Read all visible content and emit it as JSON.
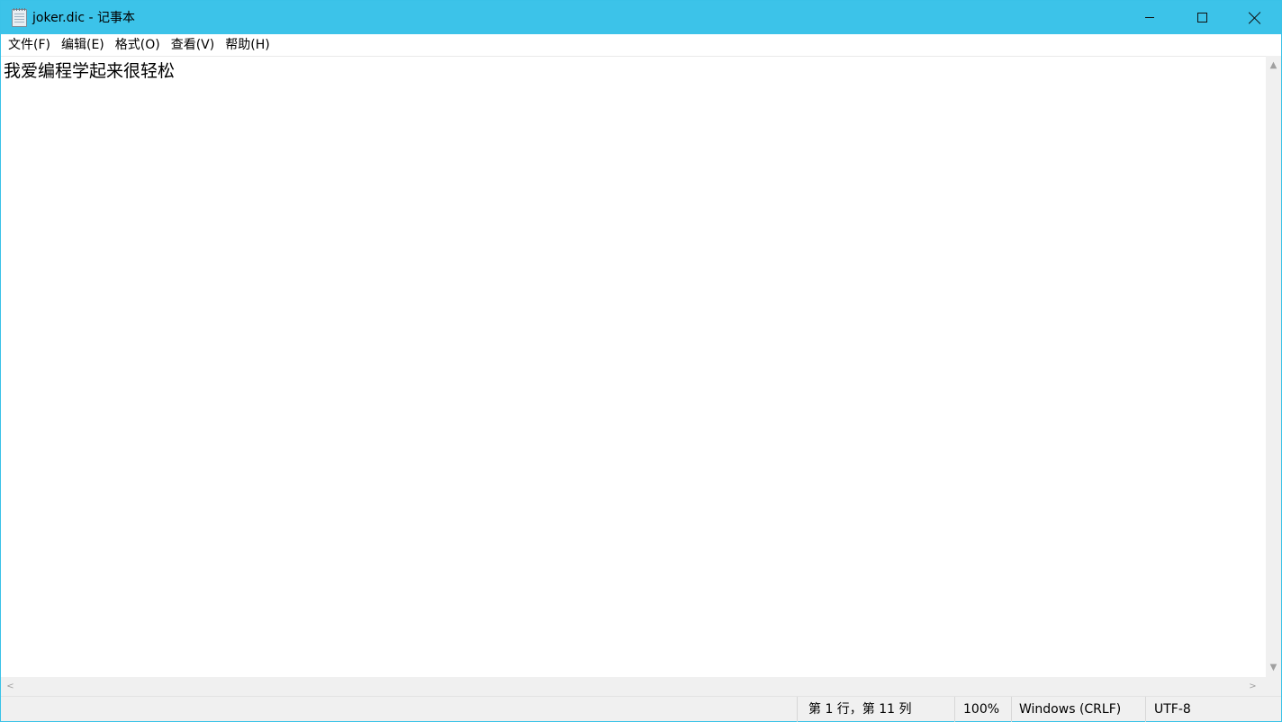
{
  "window": {
    "title": "joker.dic - 记事本",
    "icon": "notepad-icon",
    "controls": {
      "minimize": "minimize-icon",
      "maximize": "maximize-icon",
      "close": "close-icon"
    }
  },
  "menu": {
    "items": [
      {
        "label": "文件(F)"
      },
      {
        "label": "编辑(E)"
      },
      {
        "label": "格式(O)"
      },
      {
        "label": "查看(V)"
      },
      {
        "label": "帮助(H)"
      }
    ]
  },
  "editor": {
    "content": "我爱编程学起来很轻松"
  },
  "scrollbars": {
    "up": "▲",
    "down": "▼",
    "left": "<",
    "right": ">"
  },
  "status": {
    "position": "第 1 行，第 11 列",
    "zoom": "100%",
    "line_ending": "Windows (CRLF)",
    "encoding": "UTF-8"
  },
  "colors": {
    "titlebar": "#3cc3e9",
    "statusbar": "#f0f0f0"
  }
}
